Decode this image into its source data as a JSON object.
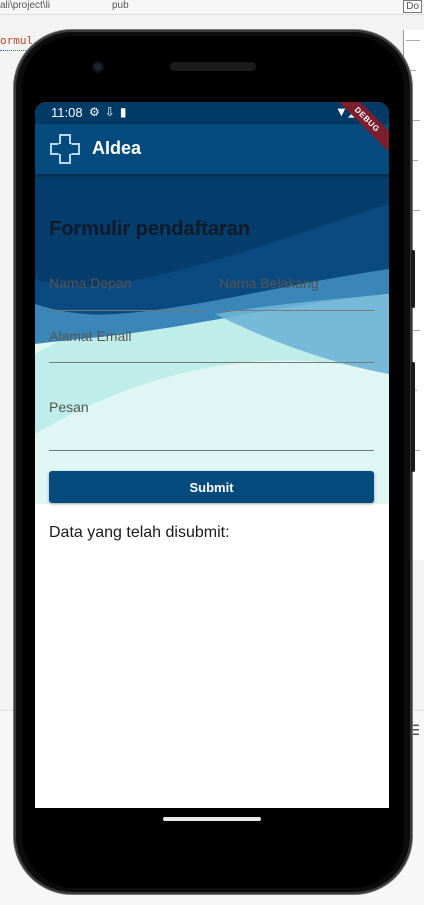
{
  "ide": {
    "path_fragment": "ali\\project\\li",
    "tab_fragment": "pub",
    "code_fragment": "ormul",
    "search_fragment": "Do"
  },
  "device": {
    "status_bar": {
      "time": "11:08",
      "left_icons": [
        "settings-icon",
        "usb-icon",
        "sd-card-icon"
      ],
      "right_icons": [
        "wifi-icon",
        "signal-icon",
        "battery-icon"
      ]
    }
  },
  "app": {
    "title": "AIdea",
    "debug_banner": "DEBUG",
    "brand_color": "#044b7d"
  },
  "form": {
    "title": "Formulir pendaftaran",
    "first_name": {
      "label": "Nama Depan",
      "value": ""
    },
    "last_name": {
      "label": "Nama Belakang",
      "value": ""
    },
    "email": {
      "label": "Alamat Email",
      "value": ""
    },
    "message": {
      "label": "Pesan",
      "value": ""
    },
    "submit_label": "Submit",
    "submitted_heading": "Data yang telah disubmit:"
  }
}
